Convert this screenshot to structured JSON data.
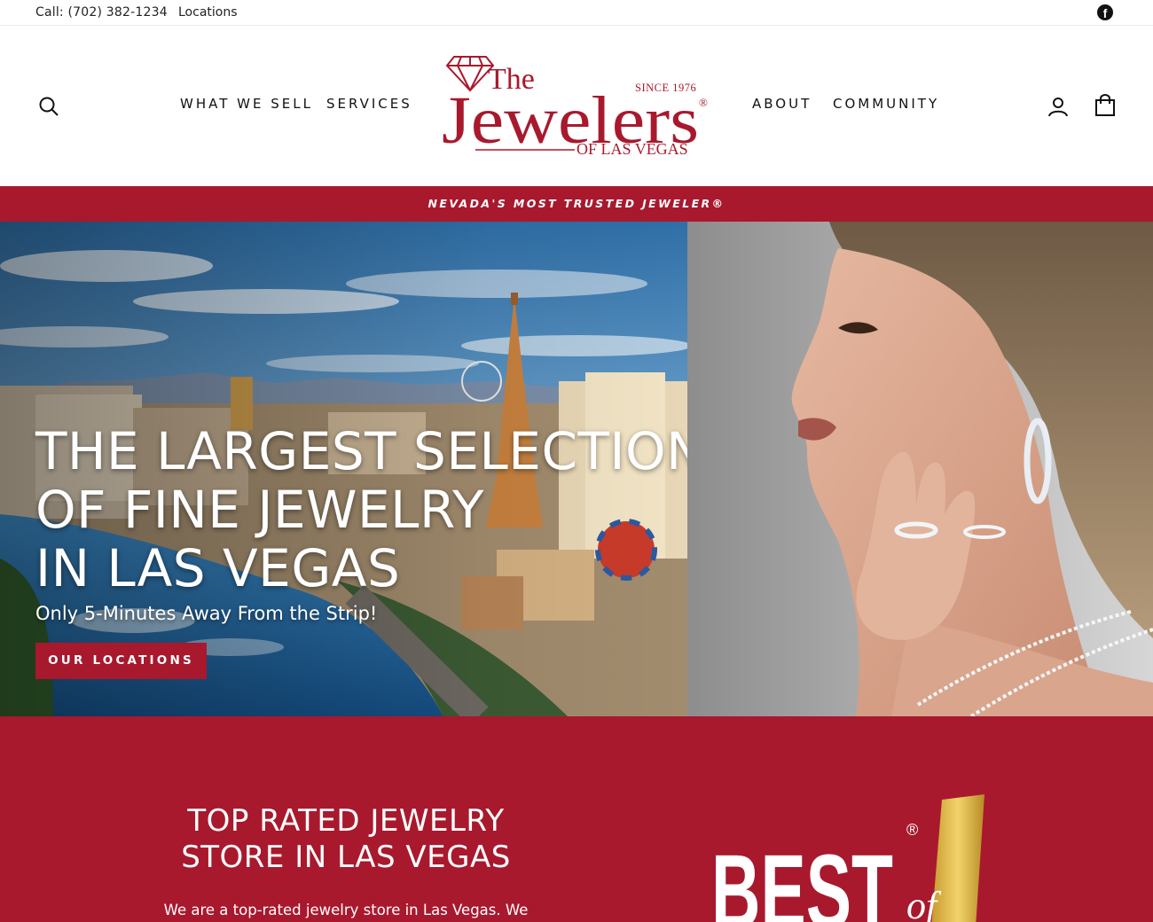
{
  "utility": {
    "phone": "Call: (702) 382-1234",
    "locations": "Locations",
    "facebook_icon": "facebook-icon"
  },
  "header": {
    "nav_left": [
      "WHAT WE SELL",
      "SERVICES"
    ],
    "nav_right": [
      "ABOUT",
      "COMMUNITY"
    ],
    "icons": [
      "search-icon",
      "account-icon",
      "cart-icon"
    ],
    "logo": {
      "line1": "The",
      "line2": "Jewelers",
      "since": "SINCE 1976",
      "line3": "OF LAS VEGAS",
      "registered": "®"
    }
  },
  "announcement": "NEVADA'S MOST TRUSTED JEWELER®",
  "hero": {
    "title_lines": [
      "THE LARGEST SELECTION",
      "OF FINE JEWELRY",
      "IN LAS VEGAS"
    ],
    "subtitle": "Only 5-Minutes Away From the Strip!",
    "button": "OUR LOCATIONS"
  },
  "rated": {
    "title_lines": [
      "TOP RATED JEWELRY",
      "STORE IN LAS VEGAS"
    ],
    "body": "We are a top-rated jewelry store in Las Vegas. We",
    "badge_word": "BEST",
    "badge_script": "of",
    "badge_registered": "®"
  },
  "colors": {
    "brand_red": "#a8192e",
    "text_dark": "#111111",
    "white": "#ffffff"
  }
}
